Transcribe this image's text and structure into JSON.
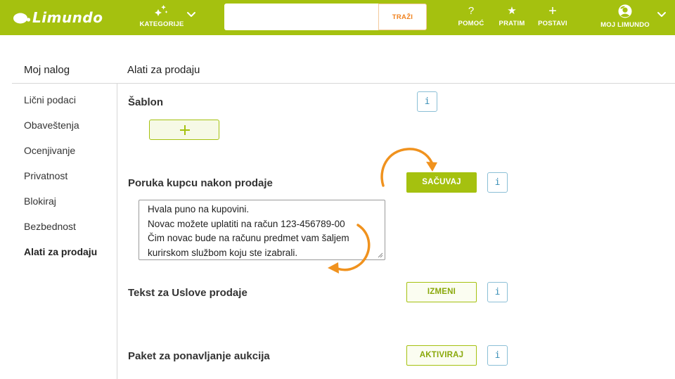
{
  "header": {
    "logo_text": "Limundo",
    "kategorije_label": "KATEGORIJE",
    "search": {
      "value": "",
      "placeholder": "",
      "button_label": "TRAŽI"
    },
    "pomoc_glyph": "?",
    "pomoc_label": "POMOĆ",
    "pratim_glyph": "★",
    "pratim_label": "PRATIM",
    "postavi_glyph": "+",
    "postavi_label": "POSTAVI",
    "user_label": "MOJ LIMUNDO"
  },
  "sidebar": {
    "title": "Moj nalog",
    "items": [
      {
        "label": "Lični podaci"
      },
      {
        "label": "Obaveštenja"
      },
      {
        "label": "Ocenjivanje"
      },
      {
        "label": "Privatnost"
      },
      {
        "label": "Blokiraj"
      },
      {
        "label": "Bezbednost"
      },
      {
        "label": "Alati za prodaju",
        "active": true
      }
    ]
  },
  "main": {
    "title": "Alati za prodaju",
    "info_glyph": "i",
    "sablon": {
      "label": "Šablon"
    },
    "poruka": {
      "label": "Poruka kupcu nakon prodaje",
      "button_label": "SAČUVAJ",
      "lines": [
        "Hvala puno na kupovini.",
        "Novac možete uplatiti na račun 123-456789-00",
        "Čim novac bude na računu predmet vam šaljem",
        "kurirskom službom koju ste izabrali."
      ]
    },
    "uslovi": {
      "label": "Tekst za Uslove prodaje",
      "button_label": "IZMENI"
    },
    "paket": {
      "label": "Paket za ponavljanje aukcija",
      "button_label": "AKTIVIRAJ"
    }
  },
  "colors": {
    "brand_green": "#a5c10f",
    "accent_orange": "#f0921e",
    "info_blue": "#3a8fb7"
  },
  "icons": {
    "logo": "lemon-logo-icon",
    "kategorije": "sparkle-icon",
    "pomoc": "question-icon",
    "pratim": "star-icon",
    "postavi": "plus-icon",
    "user": "avatar-icon",
    "dropdown": "chevron-down-icon",
    "add": "plus-icon",
    "info": "info-icon"
  }
}
